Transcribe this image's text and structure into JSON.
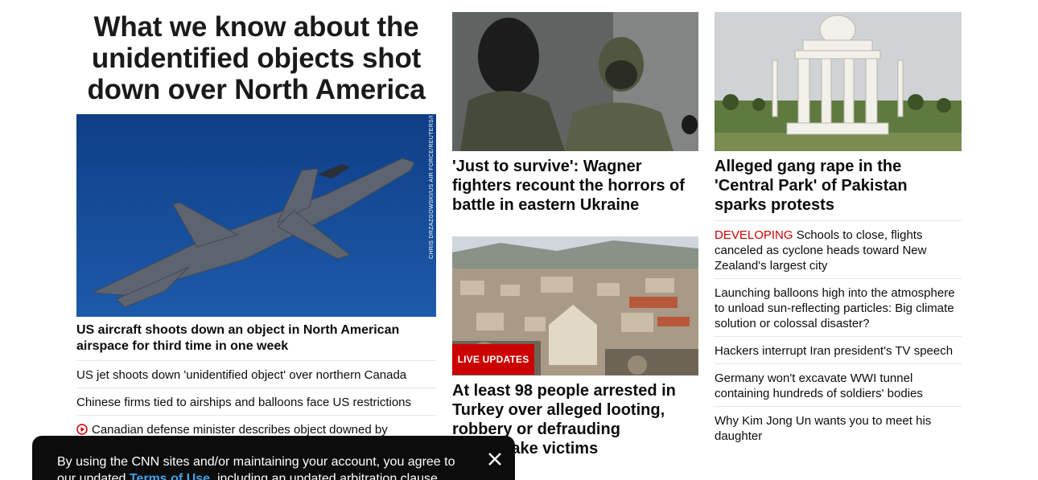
{
  "hero": {
    "title": "What we know about the unidentified objects shot down over North America",
    "image_credit": "CHRIS DRZAZGOWSKI/US AIR FORCE/REUTERS/FILE",
    "image_alt": "F-22 fighter jet",
    "headline": "US aircraft shoots down an object in North American airspace for third time in one week",
    "links": [
      "US jet shoots down 'unidentified object' over northern Canada",
      "Chinese firms tied to airships and balloons face US restrictions",
      "Canadian defense minister describes object downed by"
    ]
  },
  "middle": {
    "story1": {
      "image_alt": "Wagner fighters",
      "headline": "'Just to survive': Wagner fighters recount the horrors of battle in eastern Ukraine"
    },
    "story2": {
      "image_alt": "Earthquake damage in Turkey",
      "badge": "LIVE UPDATES",
      "headline": "At least 98 people arrested in Turkey over alleged looting, robbery or defrauding earthquake victims"
    }
  },
  "right": {
    "story": {
      "image_alt": "Minar-e-Pakistan monument",
      "headline": "Alleged gang rape in the 'Central Park' of Pakistan sparks protests"
    },
    "links": [
      {
        "prefix": "DEVELOPING",
        "text": "Schools to close, flights canceled as cyclone heads toward New Zealand's largest city"
      },
      {
        "prefix": "",
        "text": "Launching balloons high into the atmosphere to unload sun-reflecting particles: Big climate solution or colossal disaster?"
      },
      {
        "prefix": "",
        "text": "Hackers interrupt Iran president's TV speech"
      },
      {
        "prefix": "",
        "text": "Germany won't excavate WWI tunnel containing hundreds of soldiers' bodies"
      },
      {
        "prefix": "",
        "text": "Why Kim Jong Un wants you to meet his daughter"
      }
    ]
  },
  "cookie_banner": {
    "text_before": "By using the CNN sites and/or maintaining your account, you agree to our updated ",
    "link": "Terms of Use",
    "text_after": ", including an updated arbitration clause."
  },
  "colors": {
    "accent_red": "#cc0000",
    "banner_bg": "#0c0c0c",
    "banner_link": "#3fa2e8"
  }
}
